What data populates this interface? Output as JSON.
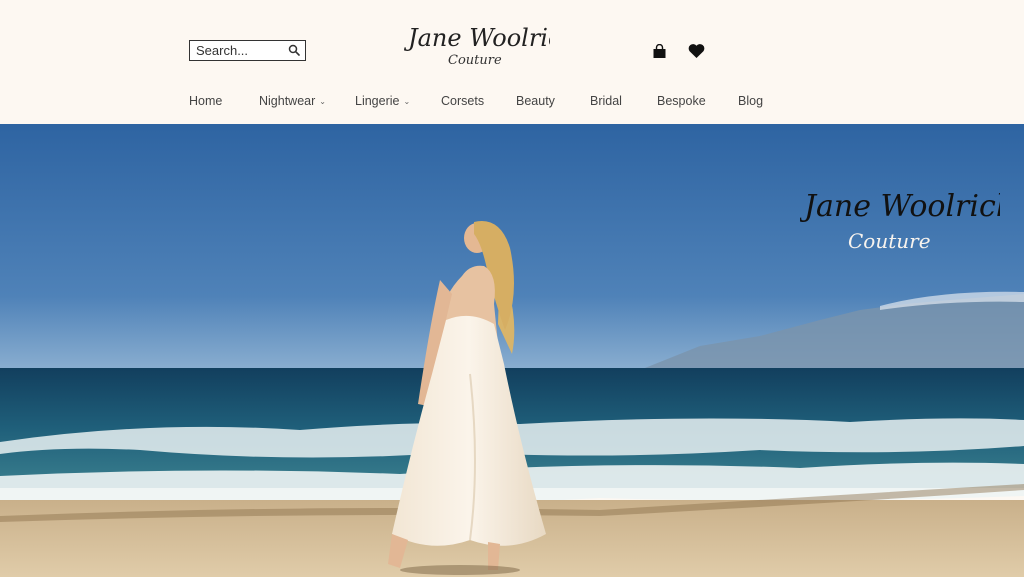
{
  "header": {
    "search": {
      "placeholder": "Search..."
    },
    "logo": {
      "script": "Jane Woolrich",
      "subtitle": "Couture"
    }
  },
  "nav": {
    "items": [
      {
        "label": "Home",
        "has_dropdown": false
      },
      {
        "label": "Nightwear",
        "has_dropdown": true
      },
      {
        "label": "Lingerie",
        "has_dropdown": true
      },
      {
        "label": "Corsets",
        "has_dropdown": false
      },
      {
        "label": "Beauty",
        "has_dropdown": false
      },
      {
        "label": "Bridal",
        "has_dropdown": false
      },
      {
        "label": "Bespoke",
        "has_dropdown": false
      },
      {
        "label": "Blog",
        "has_dropdown": false
      }
    ],
    "caret": "⌄"
  },
  "hero": {
    "logo": {
      "script": "Jane Woolrich",
      "subtitle": "Couture"
    }
  },
  "colors": {
    "header_bg": "#fdf8f2",
    "sky_top": "#2f66a4",
    "sky_bottom": "#6f9ac3",
    "sea": "#1f5a78",
    "sand": "#d8c4a2"
  },
  "icons": [
    "search-icon",
    "shopping-bag-icon",
    "heart-icon"
  ]
}
